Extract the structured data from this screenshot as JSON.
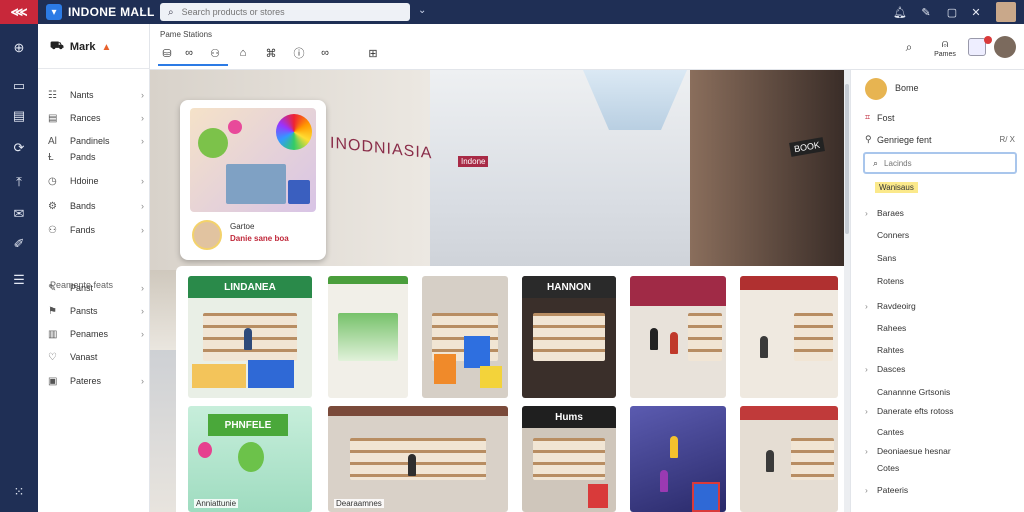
{
  "topbar": {
    "app_title": "INDONE MALL",
    "app_caret": "›",
    "search_placeholder": "Search products or stores",
    "search_icon": "search-icon",
    "dropdown_caret": "⌄",
    "icons": [
      "bell-icon",
      "pen-icon",
      "window-icon",
      "close-icon"
    ]
  },
  "rail": {
    "items": [
      "globe-icon",
      "square-icon",
      "document-icon",
      "refresh-icon",
      "upload-icon",
      "mail-icon",
      "brush-icon",
      "list-icon",
      "grid-dots-icon"
    ]
  },
  "sidebar": {
    "header": "Mark",
    "header_icon": "cart-icon",
    "items_top": [
      {
        "label": "Nants",
        "icon": "list-icon"
      },
      {
        "label": "Rances",
        "icon": "document-icon"
      },
      {
        "label": "Pandinels",
        "icon": "text-icon"
      },
      {
        "label": "Pands",
        "icon": "text-icon"
      },
      {
        "label": "Hdoine",
        "icon": "clock-icon"
      },
      {
        "label": "Bands",
        "icon": "gear-icon"
      },
      {
        "label": "Fands",
        "icon": "person-icon"
      }
    ],
    "section_label": "Peamente feats",
    "items_bottom": [
      {
        "label": "Panst",
        "icon": "edit-icon"
      },
      {
        "label": "Pansts",
        "icon": "flag-icon"
      },
      {
        "label": "Penames",
        "icon": "chart-icon"
      },
      {
        "label": "Vanast",
        "icon": "heart-icon"
      },
      {
        "label": "Pateres",
        "icon": "note-icon"
      }
    ]
  },
  "content_header": {
    "title": "Pame Stations",
    "tabs": [
      "store-icon",
      "link-icon",
      "people-icon",
      "home-icon",
      "tag-icon",
      "info-icon",
      "glasses-icon",
      "qr-icon"
    ],
    "notify_label": "Pames"
  },
  "hero": {
    "sign_big": "INODNIASIA",
    "sign_small": "Indone",
    "sign_dark": "BOOK"
  },
  "promo": {
    "name": "Gartoe",
    "sub": "Danie sane boa"
  },
  "tiles": [
    {
      "sign": "LINDANEA",
      "color": "#2a8a4a",
      "caption": ""
    },
    {
      "sign": "",
      "color": "#4a9e3c",
      "caption": ""
    },
    {
      "sign": "",
      "color": "#7a5a3a",
      "caption": ""
    },
    {
      "sign": "HANNON",
      "color": "#2a2a2a",
      "caption": ""
    },
    {
      "sign": "",
      "color": "#a02a46",
      "caption": ""
    },
    {
      "sign": "",
      "color": "#b03030",
      "caption": ""
    },
    {
      "sign": "PHNFELE",
      "color": "#4aa83a",
      "caption": "Anniattunie"
    },
    {
      "sign": "",
      "color": "#7a4a3a",
      "caption": "Dearaamnes"
    },
    {
      "sign": "Hums",
      "color": "#1f1f1f",
      "caption": ""
    },
    {
      "sign": "",
      "color": "#3a3a9a",
      "caption": ""
    },
    {
      "sign": "",
      "color": "#c03a3a",
      "caption": ""
    }
  ],
  "right_panel": {
    "name": "Bome",
    "row_1": "Fost",
    "row_2": "Genriege fent",
    "row_2_end": "R/ X",
    "search_placeholder": "Lacinds",
    "chip": "Wanisaus",
    "links": [
      {
        "label": "Baraes",
        "caret": "›"
      },
      {
        "label": "Conners",
        "caret": ""
      },
      {
        "label": "Sans",
        "caret": ""
      },
      {
        "label": "Rotens",
        "caret": ""
      },
      {
        "label": "Ravdeoirg",
        "caret": "›"
      },
      {
        "label": "Rahees",
        "caret": ""
      },
      {
        "label": "Rahtes",
        "caret": ""
      },
      {
        "label": "Dasces",
        "caret": "›"
      },
      {
        "label": "Canannne Grtsonis",
        "caret": ""
      },
      {
        "label": "Danerate efts rotoss",
        "caret": "›"
      },
      {
        "label": "Cantes",
        "caret": ""
      },
      {
        "label": "Deoniaesue hesnar",
        "caret": "›"
      },
      {
        "label": "Cotes",
        "caret": ""
      },
      {
        "label": "Pateeris",
        "caret": "›"
      }
    ]
  }
}
